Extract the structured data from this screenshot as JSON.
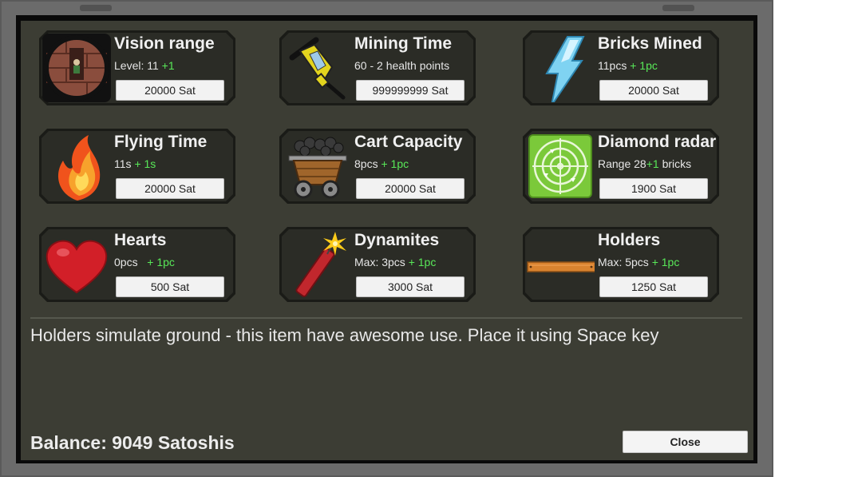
{
  "upgrades": [
    {
      "title": "Vision range",
      "stat": "Level: 11",
      "plus": "+1",
      "price": "20000 Sat",
      "icon": "vision-icon"
    },
    {
      "title": "Mining Time",
      "stat": "60 - 2  health points",
      "plus": "",
      "price": "999999999 Sat",
      "icon": "drill-icon"
    },
    {
      "title": "Bricks Mined",
      "stat": "11pcs",
      "plus": "+ 1pc",
      "price": "20000 Sat",
      "icon": "lightning-icon"
    },
    {
      "title": "Flying Time",
      "stat": "11s",
      "plus": "+ 1s",
      "price": "20000 Sat",
      "icon": "flame-icon"
    },
    {
      "title": "Cart Capacity",
      "stat": "8pcs",
      "plus": "+ 1pc",
      "price": "20000 Sat",
      "icon": "mine-cart-icon"
    },
    {
      "title": "Diamond radar",
      "stat": "Range 28",
      "plus": "+1",
      "stat_suffix": "bricks",
      "price": "1900 Sat",
      "icon": "radar-icon"
    },
    {
      "title": "Hearts",
      "stat": "0pcs",
      "plus": "+ 1pc",
      "price": "500 Sat",
      "icon": "heart-icon"
    },
    {
      "title": "Dynamites",
      "stat": "Max: 3pcs",
      "plus": "+ 1pc",
      "price": "3000 Sat",
      "icon": "dynamite-icon"
    },
    {
      "title": "Holders",
      "stat": "Max: 5pcs",
      "plus": "+ 1pc",
      "price": "1250 Sat",
      "icon": "plank-icon"
    }
  ],
  "description": "Holders simulate ground - this item have awesome use. Place it using Space key",
  "balance": "Balance: 9049 Satoshis",
  "close_label": "Close",
  "colors": {
    "panel_bg": "#3c3d34",
    "card_bg": "#2b2c26",
    "plus_green": "#58e858",
    "frame": "#6b6b6b"
  }
}
